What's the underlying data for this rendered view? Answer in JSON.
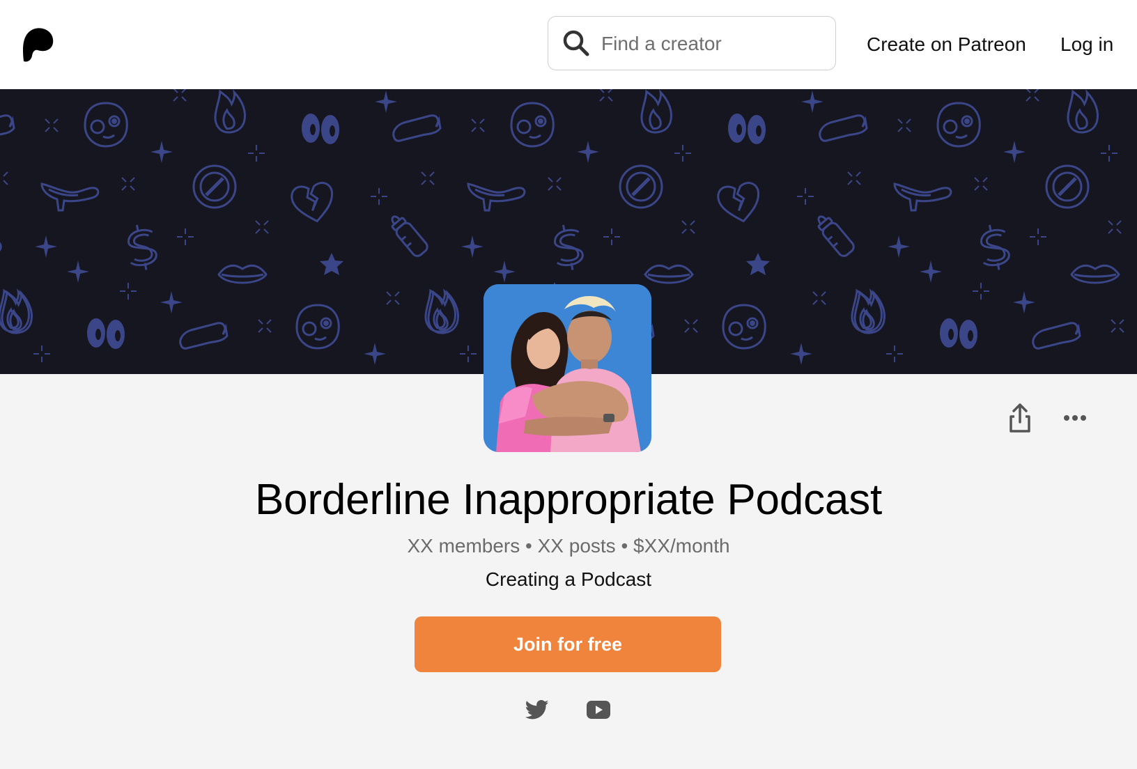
{
  "brand": {
    "logo_icon": "patreon-logo-icon"
  },
  "header": {
    "search": {
      "placeholder": "Find a creator",
      "value": "",
      "icon": "search-icon"
    },
    "create_label": "Create on Patreon",
    "login_label": "Log in"
  },
  "banner": {
    "pattern_icons": [
      "alien-face-icon",
      "flame-icon",
      "eyes-icon",
      "speech-bubble-icon",
      "sparkle-icon",
      "high-heel-icon",
      "no-symbol-icon",
      "broken-heart-icon",
      "dollar-icon",
      "baby-bottle-icon",
      "lips-icon",
      "star-icon"
    ],
    "background_color": "#15161f",
    "icon_color": "#3b4688"
  },
  "profile": {
    "name": "Borderline Inappropriate Podcast",
    "stats": "XX members • XX posts • $XX/month",
    "tagline": "Creating a Podcast",
    "join_label": "Join for free",
    "actions": [
      "share-icon",
      "more-icon"
    ],
    "socials": [
      "twitter-icon",
      "youtube-icon"
    ]
  },
  "colors": {
    "accent": "#f0843c",
    "avatar_background": "#3d86d6"
  }
}
